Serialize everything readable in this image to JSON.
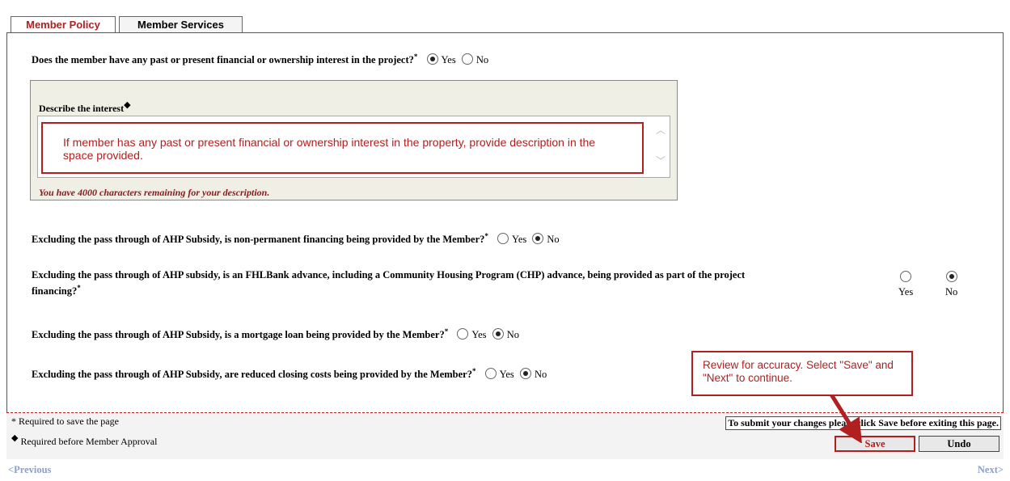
{
  "tabs": {
    "policy": "Member Policy",
    "services": "Member Services"
  },
  "q1": {
    "text": "Does the member have any past or present financial or ownership interest in the project?",
    "req": "*",
    "yes": "Yes",
    "no": "No",
    "selected": "Yes"
  },
  "describe": {
    "label": "Describe the interest",
    "marker": "◆",
    "hint": "If member has any past or present financial or ownership interest in the property, provide description in the space provided.",
    "remaining": "You have 4000 characters remaining for your description."
  },
  "q2": {
    "text": "Excluding the pass through of AHP Subsidy, is non-permanent financing being provided by the Member?",
    "req": "*",
    "yes": "Yes",
    "no": "No",
    "selected": "No"
  },
  "q3": {
    "text_line1": "Excluding the pass through of AHP subsidy, is an FHLBank advance, including a Community Housing Program (CHP) advance, being provided as part of the project",
    "text_line2": "financing?",
    "req": "*",
    "yes": "Yes",
    "no": "No",
    "selected": "No"
  },
  "q4": {
    "text": "Excluding the pass through of AHP Subsidy, is a mortgage loan being provided by the Member?",
    "req": "*",
    "yes": "Yes",
    "no": "No",
    "selected": "No"
  },
  "q5": {
    "text": "Excluding the pass through of AHP Subsidy, are reduced closing costs being provided by the Member?",
    "req": "*",
    "yes": "Yes",
    "no": "No",
    "selected": "No"
  },
  "callout": {
    "text": "Review for accuracy. Select \"Save\" and \"Next\" to continue."
  },
  "footer": {
    "required_save": "* Required to save the page",
    "required_approval": "Required before Member Approval",
    "diamond": "◆",
    "submit_note": "To submit your changes please click Save before exiting this page.",
    "save": "Save",
    "undo": "Undo"
  },
  "nav": {
    "previous": "<Previous",
    "next": "Next>"
  },
  "colors": {
    "accent": "#b02020",
    "nav_link": "#8aa0c8",
    "desc_bg": "#f0efe6"
  }
}
